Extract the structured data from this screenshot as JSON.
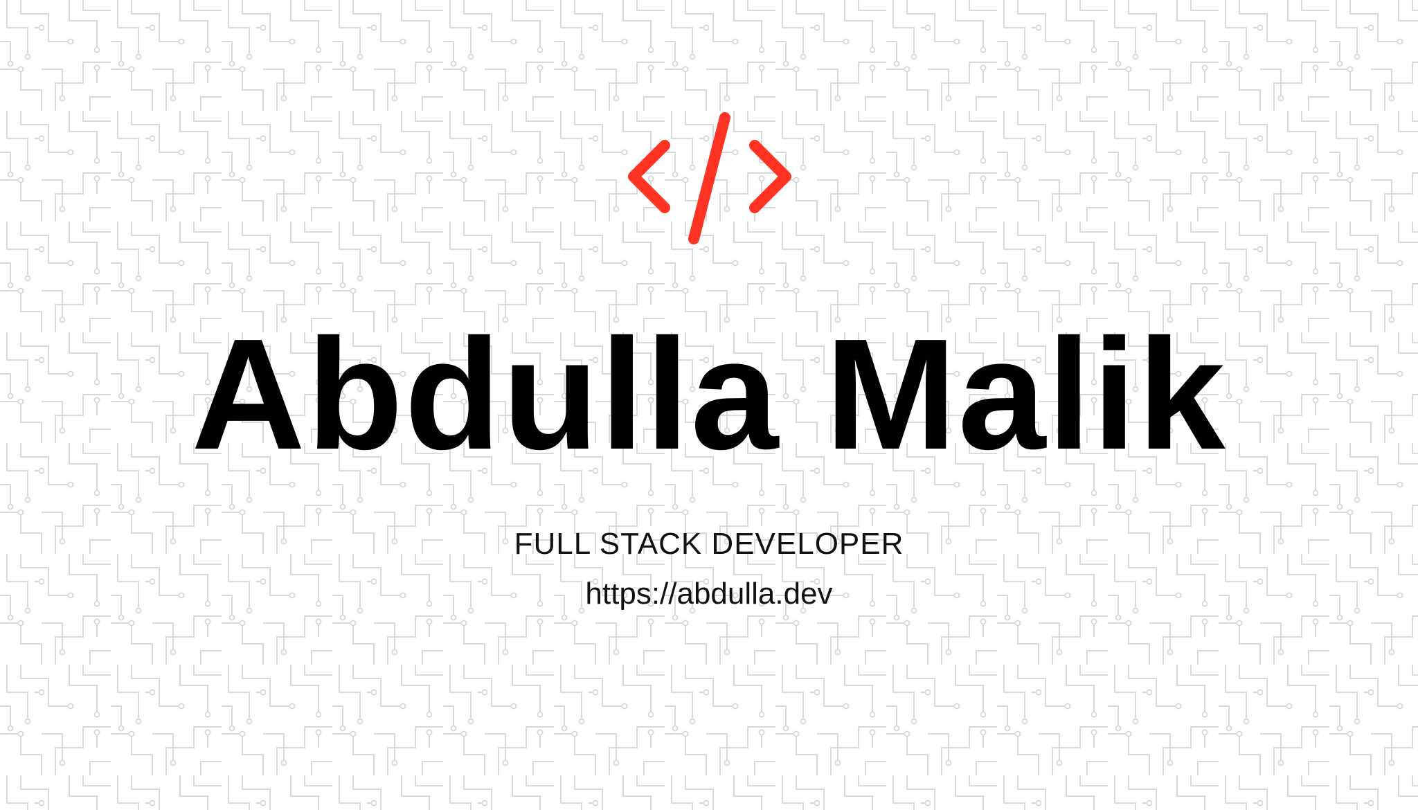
{
  "brand": {
    "accent_color": "#ff3324",
    "logo_icon": "code-brackets-icon"
  },
  "hero": {
    "name": "Abdulla Malik",
    "role": "FULL STACK DEVELOPER",
    "url": "https://abdulla.dev"
  }
}
